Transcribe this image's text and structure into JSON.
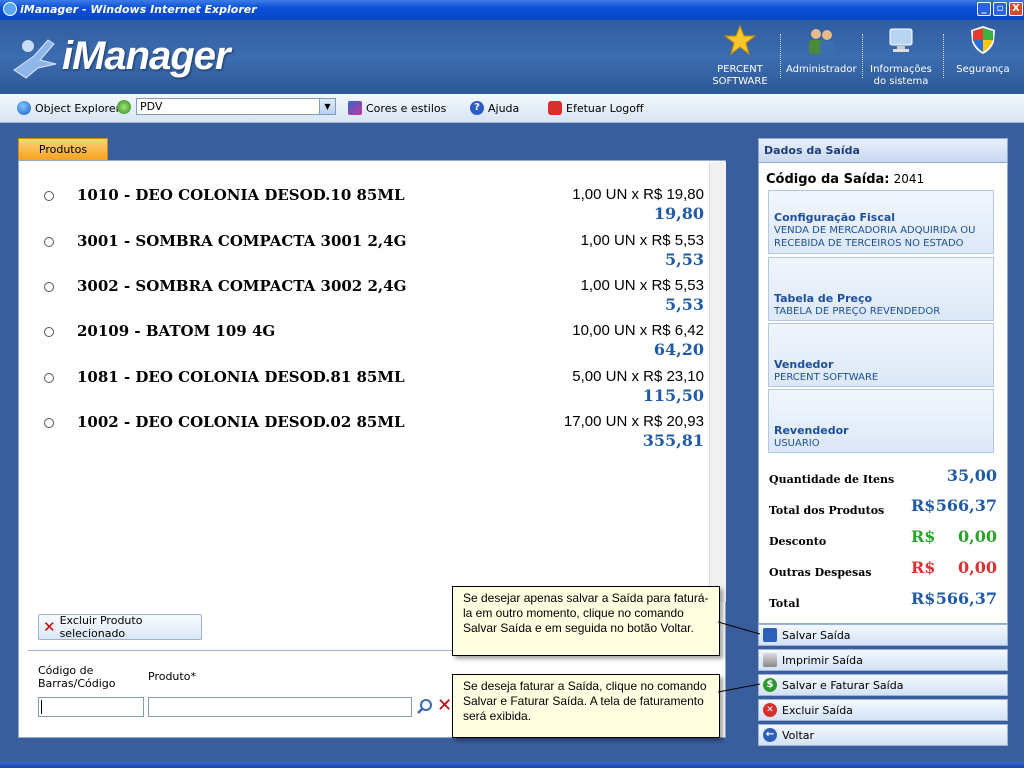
{
  "window": {
    "title": "iManager - Windows Internet Explorer",
    "min_label": "_",
    "max_label": "▫",
    "close_label": "X"
  },
  "header": {
    "logo_text": "iManager",
    "items": [
      {
        "label": "PERCENT\nSOFTWARE",
        "icon": "star-icon"
      },
      {
        "label": "Administrador",
        "icon": "users-icon"
      },
      {
        "label": "Informações\ndo sistema",
        "icon": "monitor-icon"
      },
      {
        "label": "Segurança",
        "icon": "shield-icon"
      }
    ]
  },
  "toolbar": {
    "object_explorer": "Object Explorer",
    "pdv_value": "PDV",
    "cores": "Cores e estilos",
    "ajuda": "Ajuda",
    "logoff": "Efetuar Logoff"
  },
  "produtos_tab": "Produtos",
  "products": [
    {
      "name": "1010 - DEO COLONIA DESOD.10 85ML",
      "qty": "1,00 UN x R$ 19,80",
      "total": "19,80"
    },
    {
      "name": "3001 - SOMBRA COMPACTA 3001 2,4G",
      "qty": "1,00 UN x R$ 5,53",
      "total": "5,53"
    },
    {
      "name": "3002 - SOMBRA COMPACTA 3002 2,4G",
      "qty": "1,00 UN x R$ 5,53",
      "total": "5,53"
    },
    {
      "name": "20109 - BATOM 109 4G",
      "qty": "10,00 UN x R$ 6,42",
      "total": "64,20"
    },
    {
      "name": "1081 - DEO COLONIA DESOD.81 85ML",
      "qty": "5,00 UN x R$ 23,10",
      "total": "115,50"
    },
    {
      "name": "1002 - DEO COLONIA DESOD.02 85ML",
      "qty": "17,00 UN x R$ 20,93",
      "total": "355,81"
    }
  ],
  "form": {
    "excluir_label": "Excluir Produto selecionado",
    "codigo_label": "Código de\nBarras/Código",
    "produto_label": "Produto*",
    "codigo_value": "",
    "produto_value": ""
  },
  "dados": {
    "header": "Dados da Saída",
    "codigo_label": "Código da Saída:",
    "codigo_value": "2041",
    "config_title": "Configuração Fiscal",
    "config_value": "VENDA DE MERCADORIA ADQUIRIDA OU RECEBIDA DE TERCEIROS NO ESTADO",
    "tabela_title": "Tabela de Preço",
    "tabela_value": "TABELA DE PREÇO REVENDEDOR",
    "vendedor_title": "Vendedor",
    "vendedor_value": "PERCENT SOFTWARE",
    "revendedor_title": "Revendedor",
    "revendedor_value": "USUARIO"
  },
  "totals": {
    "qtd_label": "Quantidade de Itens",
    "qtd_value": "35,00",
    "produtos_label": "Total dos Produtos",
    "produtos_cur": "R$",
    "produtos_value": "566,37",
    "desconto_label": "Desconto",
    "desconto_cur": "R$",
    "desconto_value": "0,00",
    "despesas_label": "Outras Despesas",
    "despesas_cur": "R$",
    "despesas_value": "0,00",
    "total_label": "Total",
    "total_cur": "R$",
    "total_value": "566,37"
  },
  "actions": {
    "salvar": "Salvar Saída",
    "imprimir": "Imprimir Saída",
    "faturar": "Salvar e Faturar Saída",
    "excluir": "Excluir Saída",
    "voltar": "Voltar"
  },
  "callouts": {
    "salvar": "Se desejar apenas salvar a Saída para faturá-la em outro momento, clique no comando Salvar Saída e em seguida no botão Voltar.",
    "faturar": "Se deseja faturar a Saída, clique no comando Salvar e Faturar Saída. A tela de faturamento será exibida."
  },
  "colors": {
    "blue_value": "#1f5aa8",
    "green_value": "#2aa52a",
    "red_value": "#e03030",
    "accent_tab": "#f6a21d"
  }
}
